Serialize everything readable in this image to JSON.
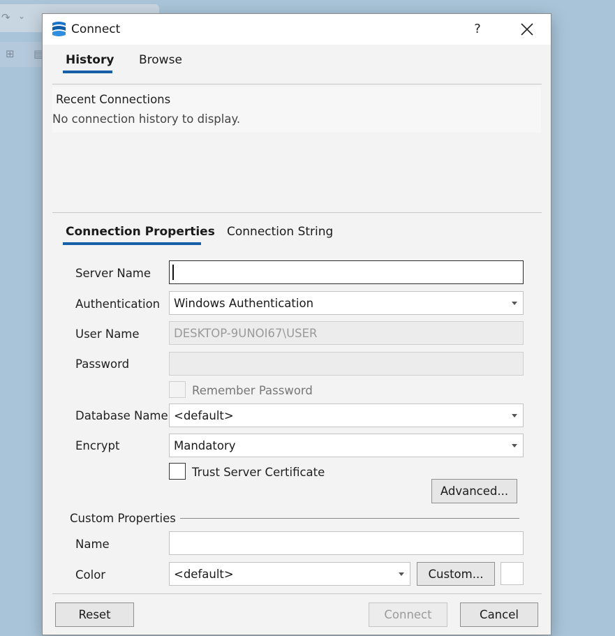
{
  "dialog": {
    "title": "Connect",
    "help_label": "?",
    "icons": {
      "app": "azure-data-studio-icon",
      "close": "close-icon"
    }
  },
  "top_tabs": [
    {
      "label": "History",
      "active": true
    },
    {
      "label": "Browse",
      "active": false
    }
  ],
  "recent": {
    "title": "Recent Connections",
    "empty_message": "No connection history to display."
  },
  "property_tabs": [
    {
      "label": "Connection Properties",
      "active": true
    },
    {
      "label": "Connection String",
      "active": false
    }
  ],
  "form": {
    "server_name": {
      "label": "Server Name",
      "value": ""
    },
    "authentication": {
      "label": "Authentication",
      "value": "Windows Authentication"
    },
    "user_name": {
      "label": "User Name",
      "value": "DESKTOP-9UNOI67\\USER"
    },
    "password": {
      "label": "Password",
      "value": ""
    },
    "remember_password": {
      "label": "Remember Password",
      "checked": false,
      "enabled": false
    },
    "database_name": {
      "label": "Database Name",
      "value": "<default>"
    },
    "encrypt": {
      "label": "Encrypt",
      "value": "Mandatory"
    },
    "trust_server_certificate": {
      "label": "Trust Server Certificate",
      "checked": false
    },
    "advanced_button": "Advanced..."
  },
  "custom_properties": {
    "group_label": "Custom Properties",
    "name": {
      "label": "Name",
      "value": ""
    },
    "color": {
      "label": "Color",
      "value": "<default>"
    },
    "custom_button": "Custom..."
  },
  "footer": {
    "reset": "Reset",
    "connect": "Connect",
    "connect_enabled": false,
    "cancel": "Cancel"
  },
  "colors": {
    "accent": "#1760a8",
    "dialog_bg": "#f3f3f3",
    "desktop_bg": "#a9c4d9"
  }
}
